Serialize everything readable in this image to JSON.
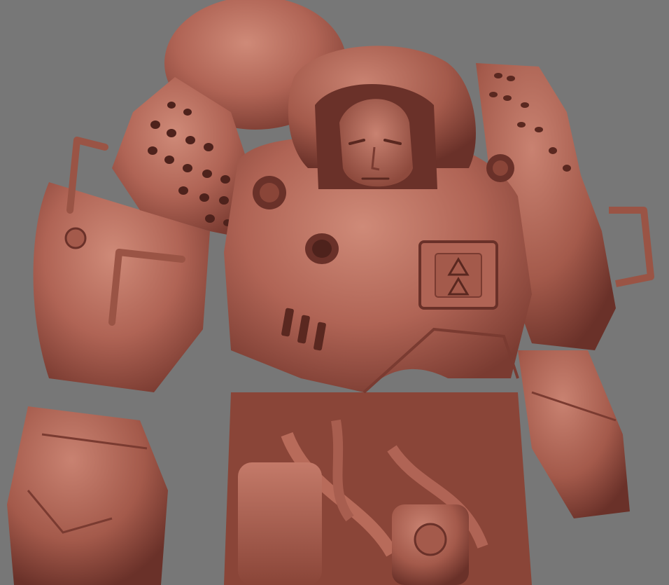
{
  "scene": {
    "subject": "armored-mech-suit-sculpt",
    "colors": {
      "background": "#777777",
      "clay_base": "#b06455",
      "clay_light": "#c98271",
      "clay_mid": "#a45a4b",
      "clay_dark": "#7a3b31",
      "clay_deep": "#4e221c"
    }
  }
}
